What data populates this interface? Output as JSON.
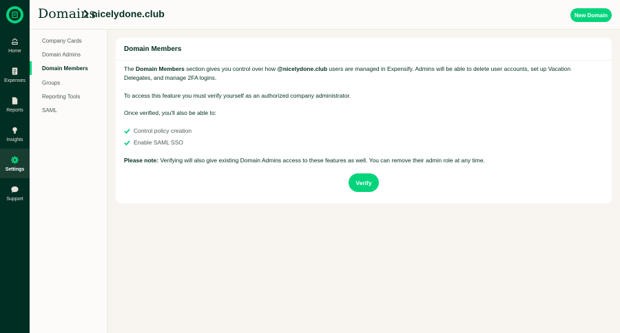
{
  "nav": {
    "items": [
      {
        "label": "Home",
        "icon": "home-icon",
        "active": false
      },
      {
        "label": "Expenses",
        "icon": "receipt-icon",
        "active": false
      },
      {
        "label": "Reports",
        "icon": "document-icon",
        "active": false
      },
      {
        "label": "Insights",
        "icon": "lightbulb-icon",
        "active": false
      },
      {
        "label": "Settings",
        "icon": "gear-icon",
        "active": true
      },
      {
        "label": "Support",
        "icon": "chat-bubble-icon",
        "active": false
      }
    ]
  },
  "header": {
    "section": "Domains",
    "domain": "nicelydone.club",
    "new_button": "New Domain"
  },
  "subnav": {
    "items": [
      {
        "label": "Company Cards",
        "active": false
      },
      {
        "label": "Domain Admins",
        "active": false
      },
      {
        "label": "Domain Members",
        "active": true
      },
      {
        "label": "Groups",
        "active": false
      },
      {
        "label": "Reporting Tools",
        "active": false
      },
      {
        "label": "SAML",
        "active": false
      }
    ]
  },
  "card": {
    "title": "Domain Members",
    "intro": {
      "part1": "The ",
      "bold1": "Domain Members",
      "part2": " section gives you control over how ",
      "bold2": "@nicelydone.club",
      "part3": " users are managed in Expensify. Admins will be able to delete user accounts, set up Vacation Delegates, and manage 2FA logins."
    },
    "access": "To access this feature you must verify yourself as an authorized company administrator.",
    "once": "Once verified, you'll also be able to:",
    "benefits": [
      "Control policy creation",
      "Enable SAML SSO"
    ],
    "note_label": "Please note:",
    "note_text": " Verifying will also give existing Domain Admins access to these features as well. You can remove their admin role at any time.",
    "verify_button": "Verify"
  },
  "colors": {
    "brand_green": "#03d47c",
    "dark_green": "#002e22",
    "background": "#f8f4f0"
  }
}
